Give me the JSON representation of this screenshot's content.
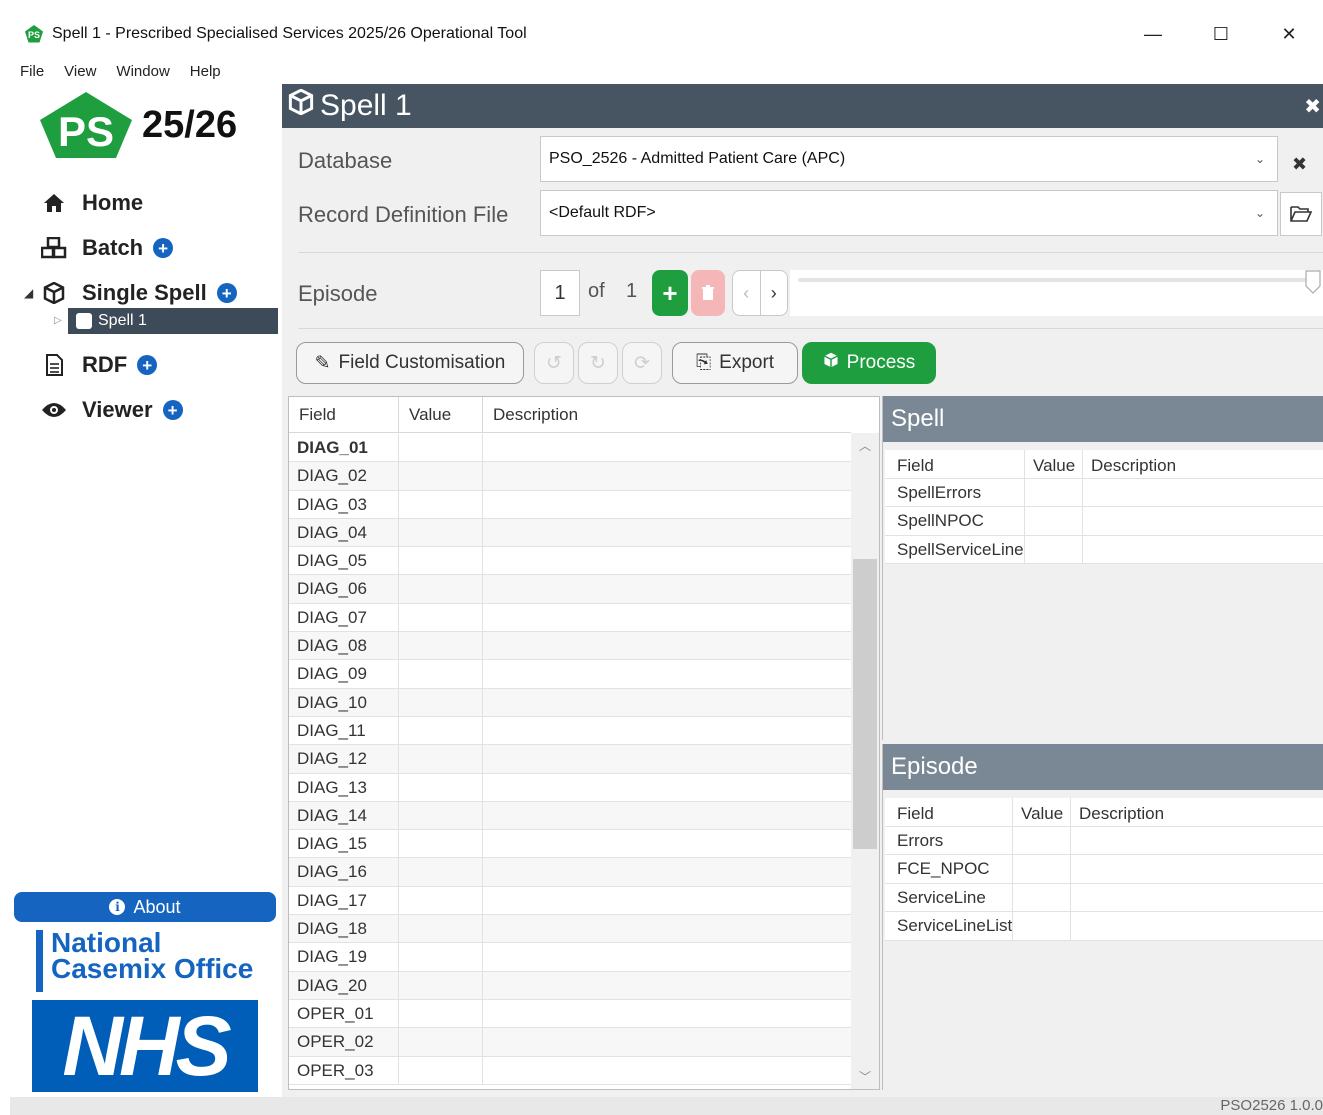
{
  "window": {
    "title": "Spell 1 - Prescribed Specialised Services 2025/26 Operational Tool",
    "app_icon_text": "PS",
    "minimize": "—",
    "maximize": "☐",
    "close": "✕"
  },
  "menu": [
    "File",
    "View",
    "Window",
    "Help"
  ],
  "sidebar": {
    "logo_text": "PS",
    "logo_year": "25/26",
    "nav": {
      "home": "Home",
      "batch": "Batch",
      "single_spell": "Single Spell",
      "spell_item": "Spell 1",
      "rdf": "RDF",
      "viewer": "Viewer"
    },
    "about": "About",
    "ncmo_line1": "National",
    "ncmo_line2": "Casemix Office",
    "nhs": "NHS"
  },
  "main": {
    "title": "Spell 1",
    "database_label": "Database",
    "database_value": "PSO_2526 - Admitted Patient Care (APC)",
    "rdf_label": "Record Definition File",
    "rdf_value": "<Default RDF>",
    "episode_label": "Episode",
    "episode_current": "1",
    "episode_of": "of",
    "episode_total": "1",
    "buttons": {
      "field_customisation": "Field Customisation",
      "export": "Export",
      "process": "Process"
    }
  },
  "fields_table": {
    "headers": [
      "Field",
      "Value",
      "Description"
    ],
    "rows": [
      "DIAG_01",
      "DIAG_02",
      "DIAG_03",
      "DIAG_04",
      "DIAG_05",
      "DIAG_06",
      "DIAG_07",
      "DIAG_08",
      "DIAG_09",
      "DIAG_10",
      "DIAG_11",
      "DIAG_12",
      "DIAG_13",
      "DIAG_14",
      "DIAG_15",
      "DIAG_16",
      "DIAG_17",
      "DIAG_18",
      "DIAG_19",
      "DIAG_20",
      "OPER_01",
      "OPER_02",
      "OPER_03"
    ]
  },
  "spell_panel": {
    "title": "Spell",
    "headers": [
      "Field",
      "Value",
      "Description"
    ],
    "rows": [
      "SpellErrors",
      "SpellNPOC",
      "SpellServiceLine"
    ]
  },
  "episode_panel": {
    "title": "Episode",
    "headers": [
      "Field",
      "Value",
      "Description"
    ],
    "rows": [
      "Errors",
      "FCE_NPOC",
      "ServiceLine",
      "ServiceLineList"
    ]
  },
  "status": {
    "version": "PSO2526 1.0.0"
  },
  "colors": {
    "header_dark": "#475461",
    "panel_header": "#7a8794",
    "accent_blue": "#1565c0",
    "green": "#1e9e3e",
    "nhs_blue": "#005eb8"
  }
}
